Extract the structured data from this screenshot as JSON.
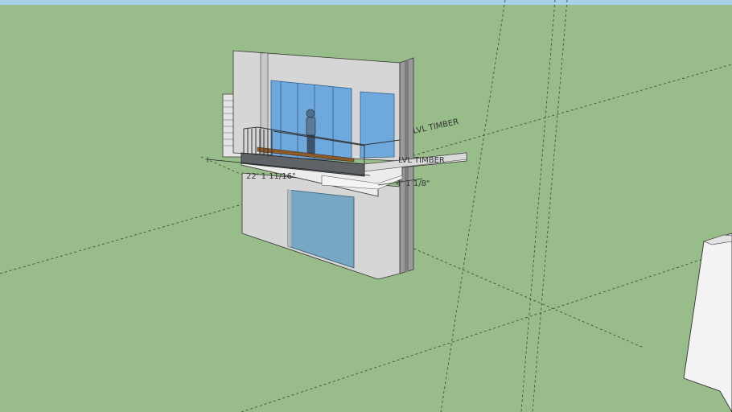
{
  "model": {
    "dimension_width": "22' 1 11/16\"",
    "dimension_depth": "4' 1 1/8\"",
    "label_timber_upper": "LVL TIMBER",
    "label_timber_lower": "LVL TIMBER"
  },
  "colors": {
    "sky": "#a8d0e8",
    "ground": "#98bd8a",
    "wall": "#d6d6d6",
    "glass": "#6fa8dc",
    "garage_door": "#77a7c3",
    "deck": "#6b6b6b",
    "timber": "#8b5a2b"
  }
}
